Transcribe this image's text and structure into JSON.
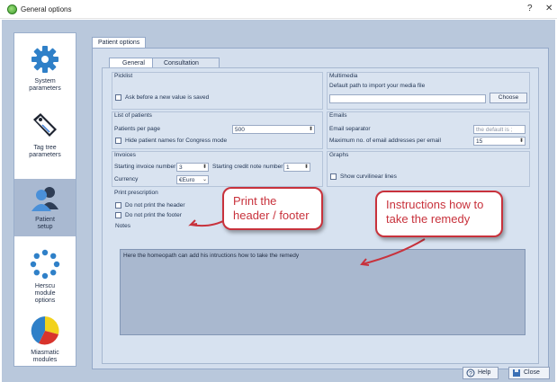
{
  "window": {
    "title": "General options",
    "help_glyph": "?",
    "close_glyph": "✕"
  },
  "sidebar": {
    "items": [
      {
        "label": "System\nparameters",
        "icon": "gear-icon"
      },
      {
        "label": "Tag tree\nparameters",
        "icon": "tag-icon"
      },
      {
        "label": "Patient\nsetup",
        "icon": "patients-icon"
      },
      {
        "label": "Herscu\nmodule\noptions",
        "icon": "dots-ring-icon"
      },
      {
        "label": "Miasmatic\nmodules",
        "icon": "pie-icon"
      }
    ]
  },
  "tabs": {
    "outer": "Patient options",
    "inner": [
      "General",
      "Consultation"
    ]
  },
  "picklist": {
    "title": "Picklist",
    "ask_label": "Ask before a new value is saved"
  },
  "multimedia": {
    "title": "Multimedia",
    "path_label": "Default path to import your media file",
    "choose_label": "Choose"
  },
  "list_of_patients": {
    "title": "List of patients",
    "per_page_label": "Patients per page",
    "per_page_value": "500",
    "hide_label": "Hide patient names for Congress mode"
  },
  "emails": {
    "title": "Emails",
    "separator_label": "Email separator",
    "separator_placeholder": "the default is ;",
    "max_label": "Maximum no. of email addresses per email",
    "max_value": "15"
  },
  "invoices": {
    "title": "Invoices",
    "start_invoice_label": "Starting invoice number",
    "start_invoice_value": "3",
    "start_credit_label": "Starting credit note number",
    "start_credit_value": "1",
    "currency_label": "Currency",
    "currency_value": "€Euro"
  },
  "graphs": {
    "title": "Graphs",
    "curvilinear_label": "Show curvilinear lines"
  },
  "print_prescription": {
    "title": "Print prescription",
    "no_header_label": "Do not print the header",
    "no_footer_label": "Do not print the footer"
  },
  "notes": {
    "title": "Notes",
    "text": "Here the homeopath can add his intructions how to take the remedy"
  },
  "callouts": {
    "print": "Print the\nheader / footer",
    "instructions": "Instructions how to\ntake the remedy"
  },
  "footer": {
    "help_label": "Help",
    "close_label": "Close"
  },
  "colors": {
    "callout_red": "#c8323c",
    "frame_blue": "#b9c8dc"
  }
}
